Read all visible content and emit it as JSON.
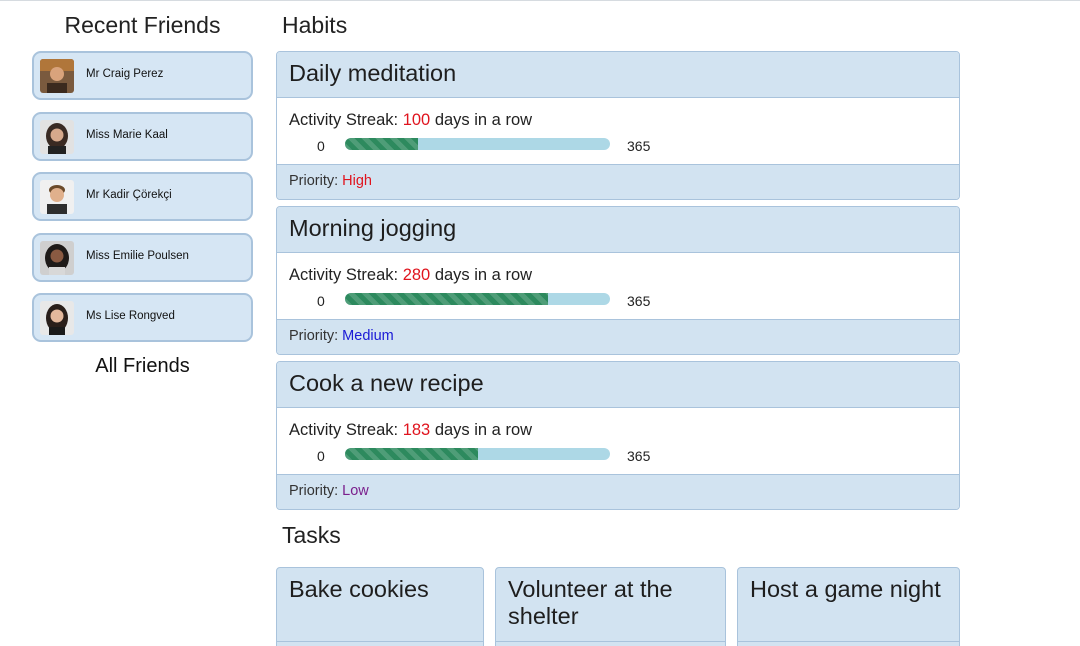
{
  "sidebar": {
    "title": "Recent Friends",
    "friends": [
      {
        "name": "Mr Craig Perez"
      },
      {
        "name": "Miss Marie Kaal"
      },
      {
        "name": "Mr Kadir Çörekçi"
      },
      {
        "name": "Miss Emilie Poulsen"
      },
      {
        "name": "Ms Lise Rongved"
      }
    ],
    "all_friends_label": "All Friends"
  },
  "habits": {
    "title": "Habits",
    "streak_prefix": "Activity Streak: ",
    "streak_suffix": " days in a row",
    "priority_prefix": "Priority: ",
    "min_label": "0",
    "max_label": "365",
    "items": [
      {
        "name": "Daily meditation",
        "streak": "100",
        "progress": 0.274,
        "priority": "High",
        "priority_color": "#e0141e"
      },
      {
        "name": "Morning jogging",
        "streak": "280",
        "progress": 0.767,
        "priority": "Medium",
        "priority_color": "#1a1ad6"
      },
      {
        "name": "Cook a new recipe",
        "streak": "183",
        "progress": 0.501,
        "priority": "Low",
        "priority_color": "#7a1f8c"
      }
    ]
  },
  "tasks": {
    "title": "Tasks",
    "items": [
      {
        "name": "Bake cookies"
      },
      {
        "name": "Volunteer at the shelter"
      },
      {
        "name": "Host a game night"
      }
    ]
  }
}
